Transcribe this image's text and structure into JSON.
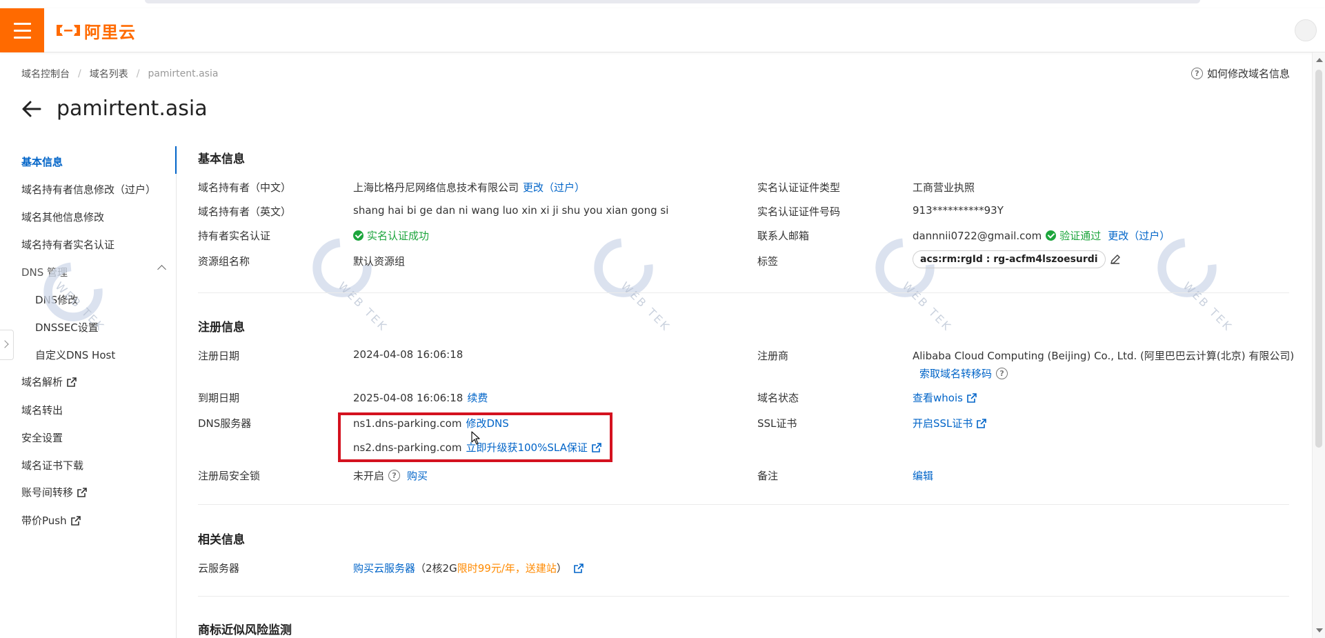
{
  "header": {
    "logo_text": "阿里云",
    "brand_color": "#ff6a00",
    "menu_icon": "hamburger-icon"
  },
  "breadcrumb": {
    "items": [
      "域名控制台",
      "域名列表",
      "pamirtent.asia"
    ],
    "separator": "/"
  },
  "help": {
    "label": "如何修改域名信息"
  },
  "page": {
    "title": "pamirtent.asia"
  },
  "sidenav": {
    "items": [
      {
        "label": "基本信息",
        "active": true
      },
      {
        "label": "域名持有者信息修改（过户）"
      },
      {
        "label": "域名其他信息修改"
      },
      {
        "label": "域名持有者实名认证"
      },
      {
        "label": "DNS 管理",
        "expanded": true
      },
      {
        "label": "DNS修改",
        "sub": true
      },
      {
        "label": "DNSSEC设置",
        "sub": true
      },
      {
        "label": "自定义DNS Host",
        "sub": true
      },
      {
        "label": "域名解析",
        "external": true
      },
      {
        "label": "域名转出"
      },
      {
        "label": "安全设置"
      },
      {
        "label": "域名证书下载"
      },
      {
        "label": "账号间转移",
        "external": true
      },
      {
        "label": "带价Push",
        "external": true
      }
    ]
  },
  "basic": {
    "title": "基本信息",
    "owner_cn_label": "域名持有者（中文）",
    "owner_cn": "上海比格丹尼网络信息技术有限公司",
    "owner_cn_action": "更改（过户）",
    "owner_en_label": "域名持有者（英文）",
    "owner_en": "shang hai bi ge dan ni wang luo xin xi ji shu you xian gong si",
    "verify_label": "持有者实名认证",
    "verify_status": "实名认证成功",
    "rg_label": "资源组名称",
    "rg_value": "默认资源组",
    "cert_type_label": "实名认证证件类型",
    "cert_type": "工商营业执照",
    "cert_no_label": "实名认证证件号码",
    "cert_no": "913**********93Y",
    "email_label": "联系人邮箱",
    "email": "dannnii0722@gmail.com",
    "email_status": "验证通过",
    "email_action": "更改（过户）",
    "tag_label": "标签",
    "tag_value": "acs:rm:rgId : rg-acfm4lszoesurdi"
  },
  "reg": {
    "title": "注册信息",
    "date_label": "注册日期",
    "date": "2024-04-08 16:06:18",
    "registrar_label": "注册商",
    "registrar": "Alibaba Cloud Computing (Beijing) Co., Ltd. (阿里巴巴云计算(北京) 有限公司)",
    "transfer_code": "索取域名转移码",
    "expire_label": "到期日期",
    "expire": "2025-04-08 16:06:18",
    "renew": "续费",
    "status_label": "域名状态",
    "whois": "查看whois",
    "dns_label": "DNS服务器",
    "ns1": "ns1.dns-parking.com",
    "ns1_action": "修改DNS",
    "ns2": "ns2.dns-parking.com",
    "ns2_action": "立即升级获100%SLA保证",
    "ssl_label": "SSL证书",
    "ssl_action": "开启SSL证书",
    "lock_label": "注册局安全锁",
    "lock_status": "未开启",
    "lock_action": "购买",
    "note_label": "备注",
    "note_action": "编辑"
  },
  "related": {
    "title": "相关信息",
    "server_label": "云服务器",
    "server_link": "购买云服务器",
    "server_detail_prefix": "（2核2G",
    "server_detail_promo": "限时99元/年，送建站",
    "server_detail_suffix": "）"
  },
  "trademark": {
    "title": "商标近似风险监测"
  },
  "watermark": {
    "text": "WEB TEK"
  },
  "colors": {
    "link": "#0064c8",
    "success": "#1ca53c",
    "promo": "#ff8a00",
    "highlight": "#d4121f"
  }
}
